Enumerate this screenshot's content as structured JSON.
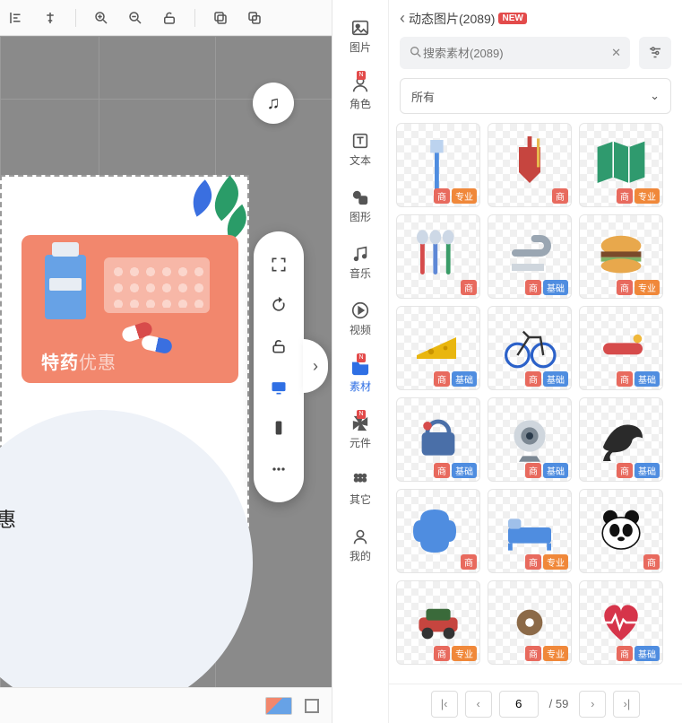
{
  "toolbar": {
    "icons": [
      "align-left-icon",
      "align-center-icon",
      "zoom-in-icon",
      "zoom-out-icon",
      "unlock-icon",
      "copy-icon",
      "paste-icon"
    ]
  },
  "artboard": {
    "card_text_bold": "特药",
    "card_text_light": "优惠",
    "edge_text": "惠"
  },
  "floating_tools": {
    "items": [
      "fullscreen-icon",
      "rotate-icon",
      "unlock-icon",
      "device-desktop-icon",
      "device-phone-icon",
      "more-icon"
    ],
    "active_index": 3,
    "expand_icon": "chevron-right-icon"
  },
  "music_button": {
    "icon": "music-note-icon"
  },
  "status": {
    "thumbnail": "artboard-thumb",
    "layout_icon": "panel-icon"
  },
  "vnav": {
    "items": [
      {
        "key": "image",
        "label": "图片",
        "icon": "image-icon",
        "badge": false
      },
      {
        "key": "role",
        "label": "角色",
        "icon": "person-icon",
        "badge": true
      },
      {
        "key": "text",
        "label": "文本",
        "icon": "text-icon",
        "badge": false
      },
      {
        "key": "shape",
        "label": "图形",
        "icon": "shapes-icon",
        "badge": false
      },
      {
        "key": "music",
        "label": "音乐",
        "icon": "music-icon",
        "badge": false
      },
      {
        "key": "video",
        "label": "视频",
        "icon": "play-icon",
        "badge": false
      },
      {
        "key": "assets",
        "label": "素材",
        "icon": "folder-icon",
        "badge": true,
        "active": true
      },
      {
        "key": "components",
        "label": "元件",
        "icon": "pinwheel-icon",
        "badge": true
      },
      {
        "key": "other",
        "label": "其它",
        "icon": "grid-icon",
        "badge": false
      },
      {
        "key": "mine",
        "label": "我的",
        "icon": "user-icon",
        "badge": false
      }
    ]
  },
  "panel": {
    "breadcrumb": {
      "back_icon": "chevron-left-icon",
      "title": "动态图片(2089)",
      "new_badge": "NEW"
    },
    "search": {
      "icon": "search-icon",
      "placeholder": "搜索素材(2089)",
      "clear_icon": "x-icon",
      "filter_icon": "filter-icon"
    },
    "dropdown": {
      "value": "所有",
      "chevron": "chevron-down-icon"
    },
    "tiles": [
      {
        "name": "toothbrush",
        "color": "#4f8de0",
        "tags": [
          "商",
          "专业"
        ]
      },
      {
        "name": "dustpan",
        "color": "#c6453f",
        "tags": [
          "商"
        ]
      },
      {
        "name": "map",
        "color": "#2f9a6e",
        "tags": [
          "商",
          "专业"
        ]
      },
      {
        "name": "cutlery",
        "color": "#5e88d6",
        "tags": [
          "商"
        ]
      },
      {
        "name": "faucet",
        "color": "#9aa6b2",
        "tags": [
          "商",
          "基础"
        ]
      },
      {
        "name": "burger",
        "color": "#d98a2d",
        "tags": [
          "商",
          "专业"
        ]
      },
      {
        "name": "cheese",
        "color": "#e9b60f",
        "tags": [
          "商",
          "基础"
        ]
      },
      {
        "name": "bicycle",
        "color": "#2b61c9",
        "tags": [
          "商",
          "基础"
        ]
      },
      {
        "name": "tool",
        "color": "#d64b4b",
        "tags": [
          "商",
          "基础"
        ]
      },
      {
        "name": "camera-bag",
        "color": "#4a6fa8",
        "tags": [
          "商",
          "基础"
        ]
      },
      {
        "name": "webcam",
        "color": "#7c8893",
        "tags": [
          "商",
          "基础"
        ]
      },
      {
        "name": "crow",
        "color": "#2a2a2a",
        "tags": [
          "商",
          "基础"
        ]
      },
      {
        "name": "brain",
        "color": "#4f8de0",
        "tags": [
          "商"
        ]
      },
      {
        "name": "bed",
        "color": "#4f8de0",
        "tags": [
          "商",
          "专业"
        ]
      },
      {
        "name": "panda",
        "color": "#111",
        "tags": [
          "商"
        ]
      },
      {
        "name": "car",
        "color": "#c6453f",
        "tags": [
          "商",
          "专业"
        ]
      },
      {
        "name": "donut",
        "color": "#8c6a48",
        "tags": [
          "商",
          "专业"
        ]
      },
      {
        "name": "heartbeat",
        "color": "#d6344a",
        "tags": [
          "商",
          "基础"
        ]
      }
    ],
    "tag_labels": {
      "商": "商",
      "专业": "专业",
      "基础": "基础"
    },
    "pager": {
      "first_icon": "first-icon",
      "prev_icon": "prev-icon",
      "page": "6",
      "total_label": "/ 59",
      "next_icon": "next-icon",
      "last_icon": "last-icon"
    }
  }
}
